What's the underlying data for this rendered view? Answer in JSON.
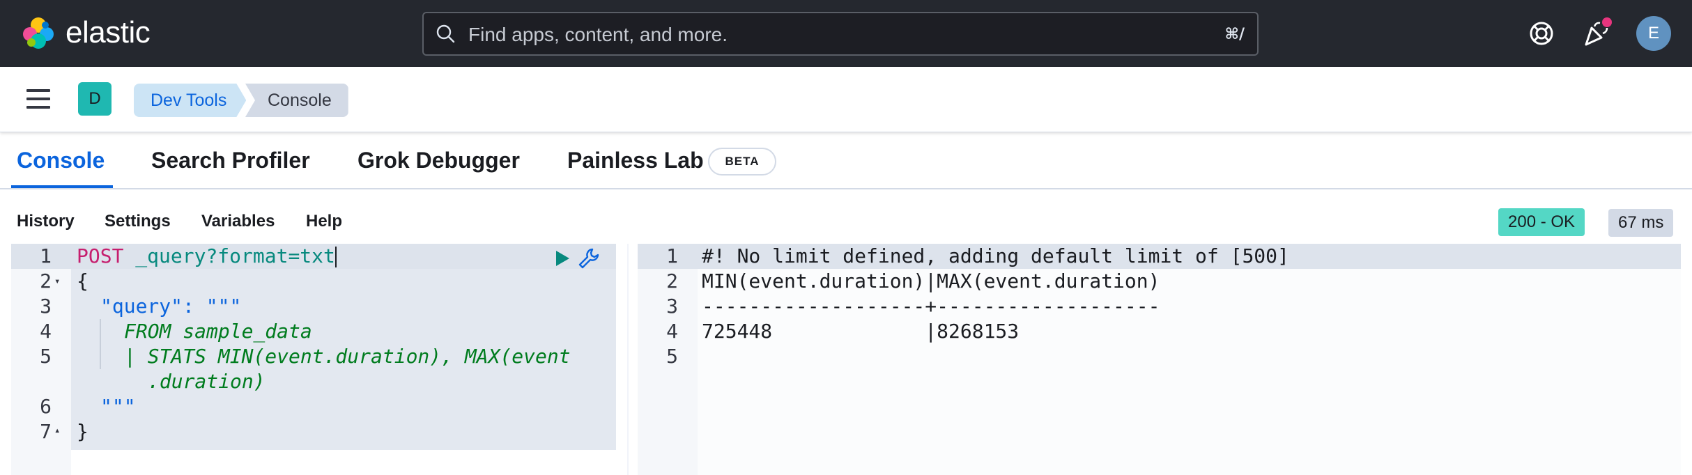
{
  "header": {
    "brand": "elastic",
    "search_placeholder": "Find apps, content, and more.",
    "search_shortcut": "⌘/",
    "avatar_initial": "E"
  },
  "breadcrumb": {
    "space_initial": "D",
    "items": [
      "Dev Tools",
      "Console"
    ]
  },
  "tabs": [
    {
      "label": "Console",
      "active": true
    },
    {
      "label": "Search Profiler"
    },
    {
      "label": "Grok Debugger"
    },
    {
      "label": "Painless Lab",
      "badge": "BETA"
    }
  ],
  "menu": [
    "History",
    "Settings",
    "Variables",
    "Help"
  ],
  "status": {
    "code": "200 - OK",
    "time": "67 ms",
    "code_color": "#54d7c5"
  },
  "request": {
    "line_numbers": [
      "1",
      "2",
      "3",
      "4",
      "5",
      "6",
      "7"
    ],
    "method": "POST",
    "path": "_query?format=txt",
    "open_brace": "{",
    "query_key": "\"query\"",
    "colon_triple": ": \"\"\"",
    "esql_line1": "FROM sample_data",
    "esql_line2a": "| STATS MIN(event.duration), MAX(event",
    "esql_line2b": ".duration)",
    "close_triple": "\"\"\"",
    "close_brace": "}"
  },
  "response": {
    "line_numbers": [
      "1",
      "2",
      "3",
      "4",
      "5"
    ],
    "lines": [
      "#! No limit defined, adding default limit of [500]",
      "MIN(event.duration)|MAX(event.duration)",
      "-------------------+-------------------",
      "725448             |8268153",
      ""
    ]
  },
  "icons": {
    "search": "search-icon",
    "help": "lifebuoy-icon",
    "news": "party-popper-icon",
    "run": "play-icon",
    "settings": "wrench-icon"
  }
}
